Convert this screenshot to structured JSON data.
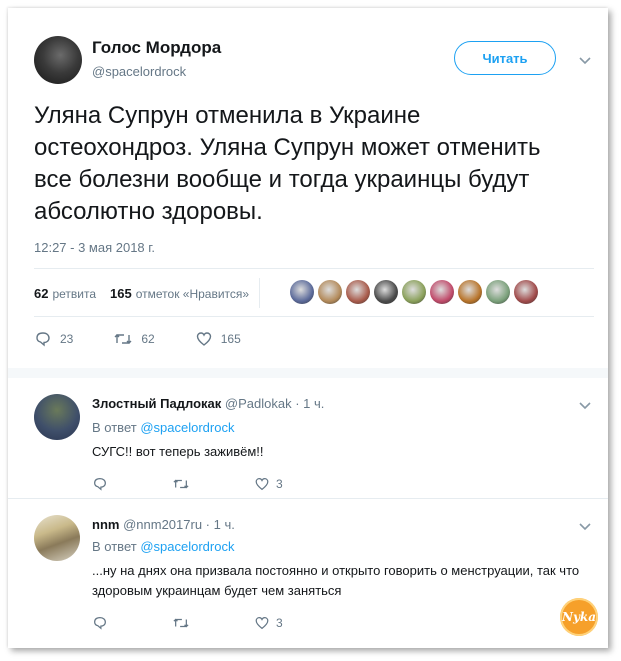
{
  "tweet": {
    "author_name": "Голос Мордора",
    "author_handle": "@spacelordrock",
    "follow_label": "Читать",
    "text": "Уляна Супрун отменила в Украине остеохондроз. Уляна Супрун может отменить все болезни вообще и тогда украинцы будут абсолютно здоровы.",
    "timestamp": "12:27 - 3 мая 2018 г.",
    "retweets_count": "62",
    "retweets_label": "ретвита",
    "likes_count": "165",
    "likes_label": "отметок «Нравится»",
    "actions": {
      "replies": "23",
      "retweets": "62",
      "likes": "165"
    },
    "liker_colors": [
      "#5b6a9a",
      "#b38a5a",
      "#a85a4a",
      "#4a4a4a",
      "#8aa05a",
      "#c04a6a",
      "#b8742a",
      "#7aa07a",
      "#a04a4a"
    ]
  },
  "replies": [
    {
      "name": "Злостный Падлокак",
      "handle": "@Padlokak",
      "time": "· 1 ч.",
      "in_reply_prefix": "В ответ",
      "in_reply_handle": "@spacelordrock",
      "text": "СУГС!! вот теперь заживём!!",
      "likes": "3"
    },
    {
      "name": "nnm",
      "handle": "@nnm2017ru",
      "time": "· 1 ч.",
      "in_reply_prefix": "В ответ",
      "in_reply_handle": "@spacelordrock",
      "text": "...ну на днях она призвала постоянно и открыто говорить о менструации, так что здоровым украинцам будет чем заняться",
      "likes": "3"
    }
  ],
  "watermark": "Nyka",
  "colors": {
    "accent": "#1da1f2",
    "muted": "#657786",
    "text": "#14171a",
    "border": "#e6ecf0"
  }
}
